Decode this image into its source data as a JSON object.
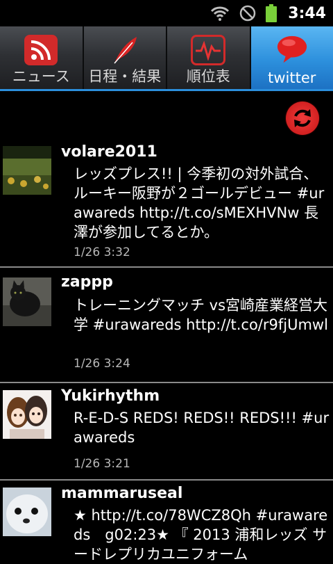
{
  "status_bar": {
    "time": "3:44",
    "icons": [
      "wifi-icon",
      "no-sync-icon",
      "battery-icon"
    ]
  },
  "tabs": [
    {
      "label": "ニュース",
      "icon": "rss-icon",
      "active": false
    },
    {
      "label": "日程・結果",
      "icon": "feather-icon",
      "active": false
    },
    {
      "label": "順位表",
      "icon": "chart-icon",
      "active": false
    },
    {
      "label": "twitter",
      "icon": "speech-bubble-icon",
      "active": true
    }
  ],
  "refresh": {
    "icon": "refresh-icon"
  },
  "tweets": [
    {
      "user": "volare2011",
      "text": "レッズプレス!! | 今季初の対外試合、ルーキー阪野が２ゴールデビュー #urawareds http://t.co/sMEXHVNw 長澤が参加してるとか。",
      "time": "1/26 3:32"
    },
    {
      "user": "zappp",
      "text": "トレーニングマッチ vs宮崎産業経営大学 #urawareds http://t.co/r9fjUmwl",
      "time": "1/26 3:24"
    },
    {
      "user": "Yukirhythm",
      "text": "R-E-D-S REDS! REDS!! REDS!!! #urawareds",
      "time": "1/26 3:21"
    },
    {
      "user": "mammaruseal",
      "text": "★ http://t.co/78WCZ8Qh #urawareds　g02:23★ 『 2013 浦和レッズ サードレプリカユニフォーム",
      "time": ""
    }
  ]
}
